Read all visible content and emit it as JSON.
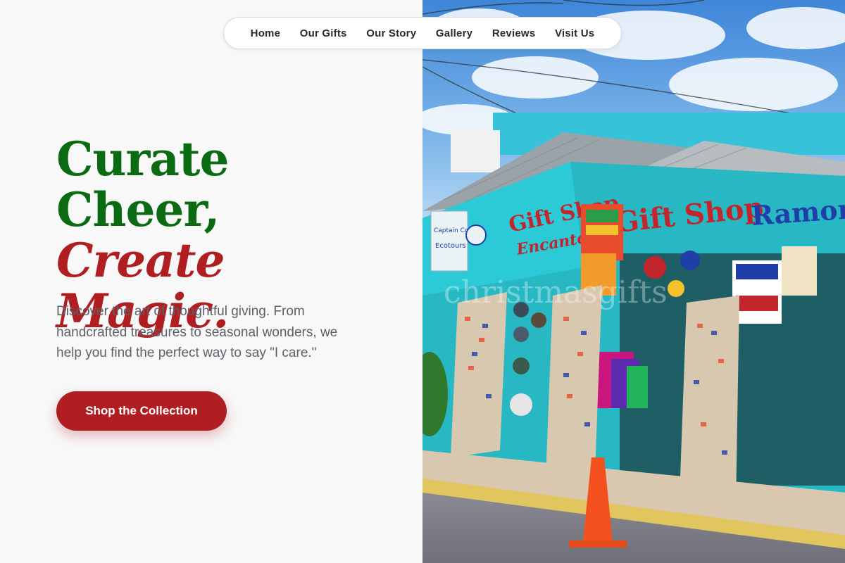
{
  "nav": {
    "items": [
      {
        "label": "Home"
      },
      {
        "label": "Our Gifts"
      },
      {
        "label": "Our Story"
      },
      {
        "label": "Gallery"
      },
      {
        "label": "Reviews"
      },
      {
        "label": "Visit Us"
      }
    ]
  },
  "hero": {
    "headline_line1": "Curate",
    "headline_line2": "Cheer,",
    "headline_line3": "Create Magic.",
    "lead": "Discover the art of thoughtful giving. From handcrafted treasures to seasonal wonders, we help you find the perfect way to say \"I care.\"",
    "cta_label": "Shop the Collection"
  },
  "photo": {
    "signs": {
      "gift_shop": "Gift Shop",
      "gift_shop_left": "Gift Shop",
      "ramon": "Ramon",
      "encanto": "Encanto",
      "captain_coco": "Captain Coco",
      "ecotours": "Ecotours"
    },
    "watermark": "christmasgifts"
  },
  "colors": {
    "green": "#0b6b12",
    "red": "#b01e22",
    "turquoise": "#27b8c4",
    "text_gray": "#5e6068"
  }
}
